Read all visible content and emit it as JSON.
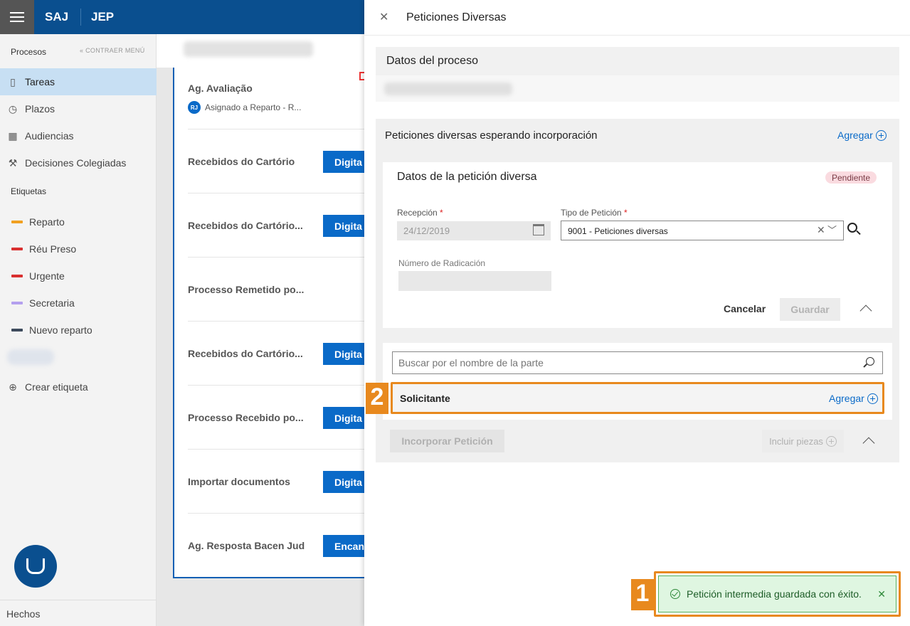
{
  "topbar": {
    "brand1": "SAJ",
    "brand2": "JEP"
  },
  "sidebar": {
    "section_title": "Procesos",
    "collapse_label": "CONTRAER MENÚ",
    "nav": [
      {
        "label": "Tareas",
        "icon": "bookmark-icon"
      },
      {
        "label": "Plazos",
        "icon": "clock-icon"
      },
      {
        "label": "Audiencias",
        "icon": "calendar-icon"
      },
      {
        "label": "Decisiones Colegiadas",
        "icon": "gavel-icon"
      }
    ],
    "tags_title": "Etiquetas",
    "tags": [
      {
        "label": "Reparto",
        "color": "#f0a020"
      },
      {
        "label": "Réu Preso",
        "color": "#d93030"
      },
      {
        "label": "Urgente",
        "color": "#d93030"
      },
      {
        "label": "Secretaria",
        "color": "#b4a0ee"
      },
      {
        "label": "Nuevo reparto",
        "color": "#3d4a5c"
      }
    ],
    "create_tag": "Crear etiqueta",
    "footer": "Hechos"
  },
  "tasks": {
    "first": {
      "title": "Ag. Avaliação",
      "initials": "RJ",
      "assigned": "Asignado a Reparto - R..."
    },
    "rows": [
      {
        "title": "Recebidos do Cartório",
        "button": "Digita"
      },
      {
        "title": "Recebidos do Cartório...",
        "button": "Digita"
      },
      {
        "title": "Processo Remetido po...",
        "button": ""
      },
      {
        "title": "Recebidos do Cartório...",
        "button": "Digita"
      },
      {
        "title": "Processo Recebido po...",
        "button": "Digita"
      },
      {
        "title": "Importar documentos",
        "button": "Digita"
      },
      {
        "title": "Ag. Resposta Bacen Jud",
        "button": "Encan"
      }
    ]
  },
  "panel": {
    "title": "Peticiones Diversas",
    "datos_proceso": "Datos del proceso",
    "peticiones_header": "Peticiones diversas esperando incorporación",
    "agregar": "Agregar",
    "datos_peticion": "Datos de la petición diversa",
    "status": "Pendiente",
    "recepcion_label": "Recepción",
    "recepcion_value": "24/12/2019",
    "tipo_label": "Tipo de Petición",
    "tipo_value": "9001 - Peticiones diversas",
    "radicacion_label": "Número de Radicación",
    "required_mark": "*",
    "cancelar": "Cancelar",
    "guardar": "Guardar",
    "buscar_placeholder": "Buscar por el nombre de la parte",
    "solicitante": "Solicitante",
    "incorporar": "Incorporar Petición",
    "incluir": "Incluir piezas"
  },
  "toast": {
    "message": "Petición intermedia guardada con éxito."
  },
  "callouts": {
    "one": "1",
    "two": "2",
    "color": "#e8891e"
  }
}
